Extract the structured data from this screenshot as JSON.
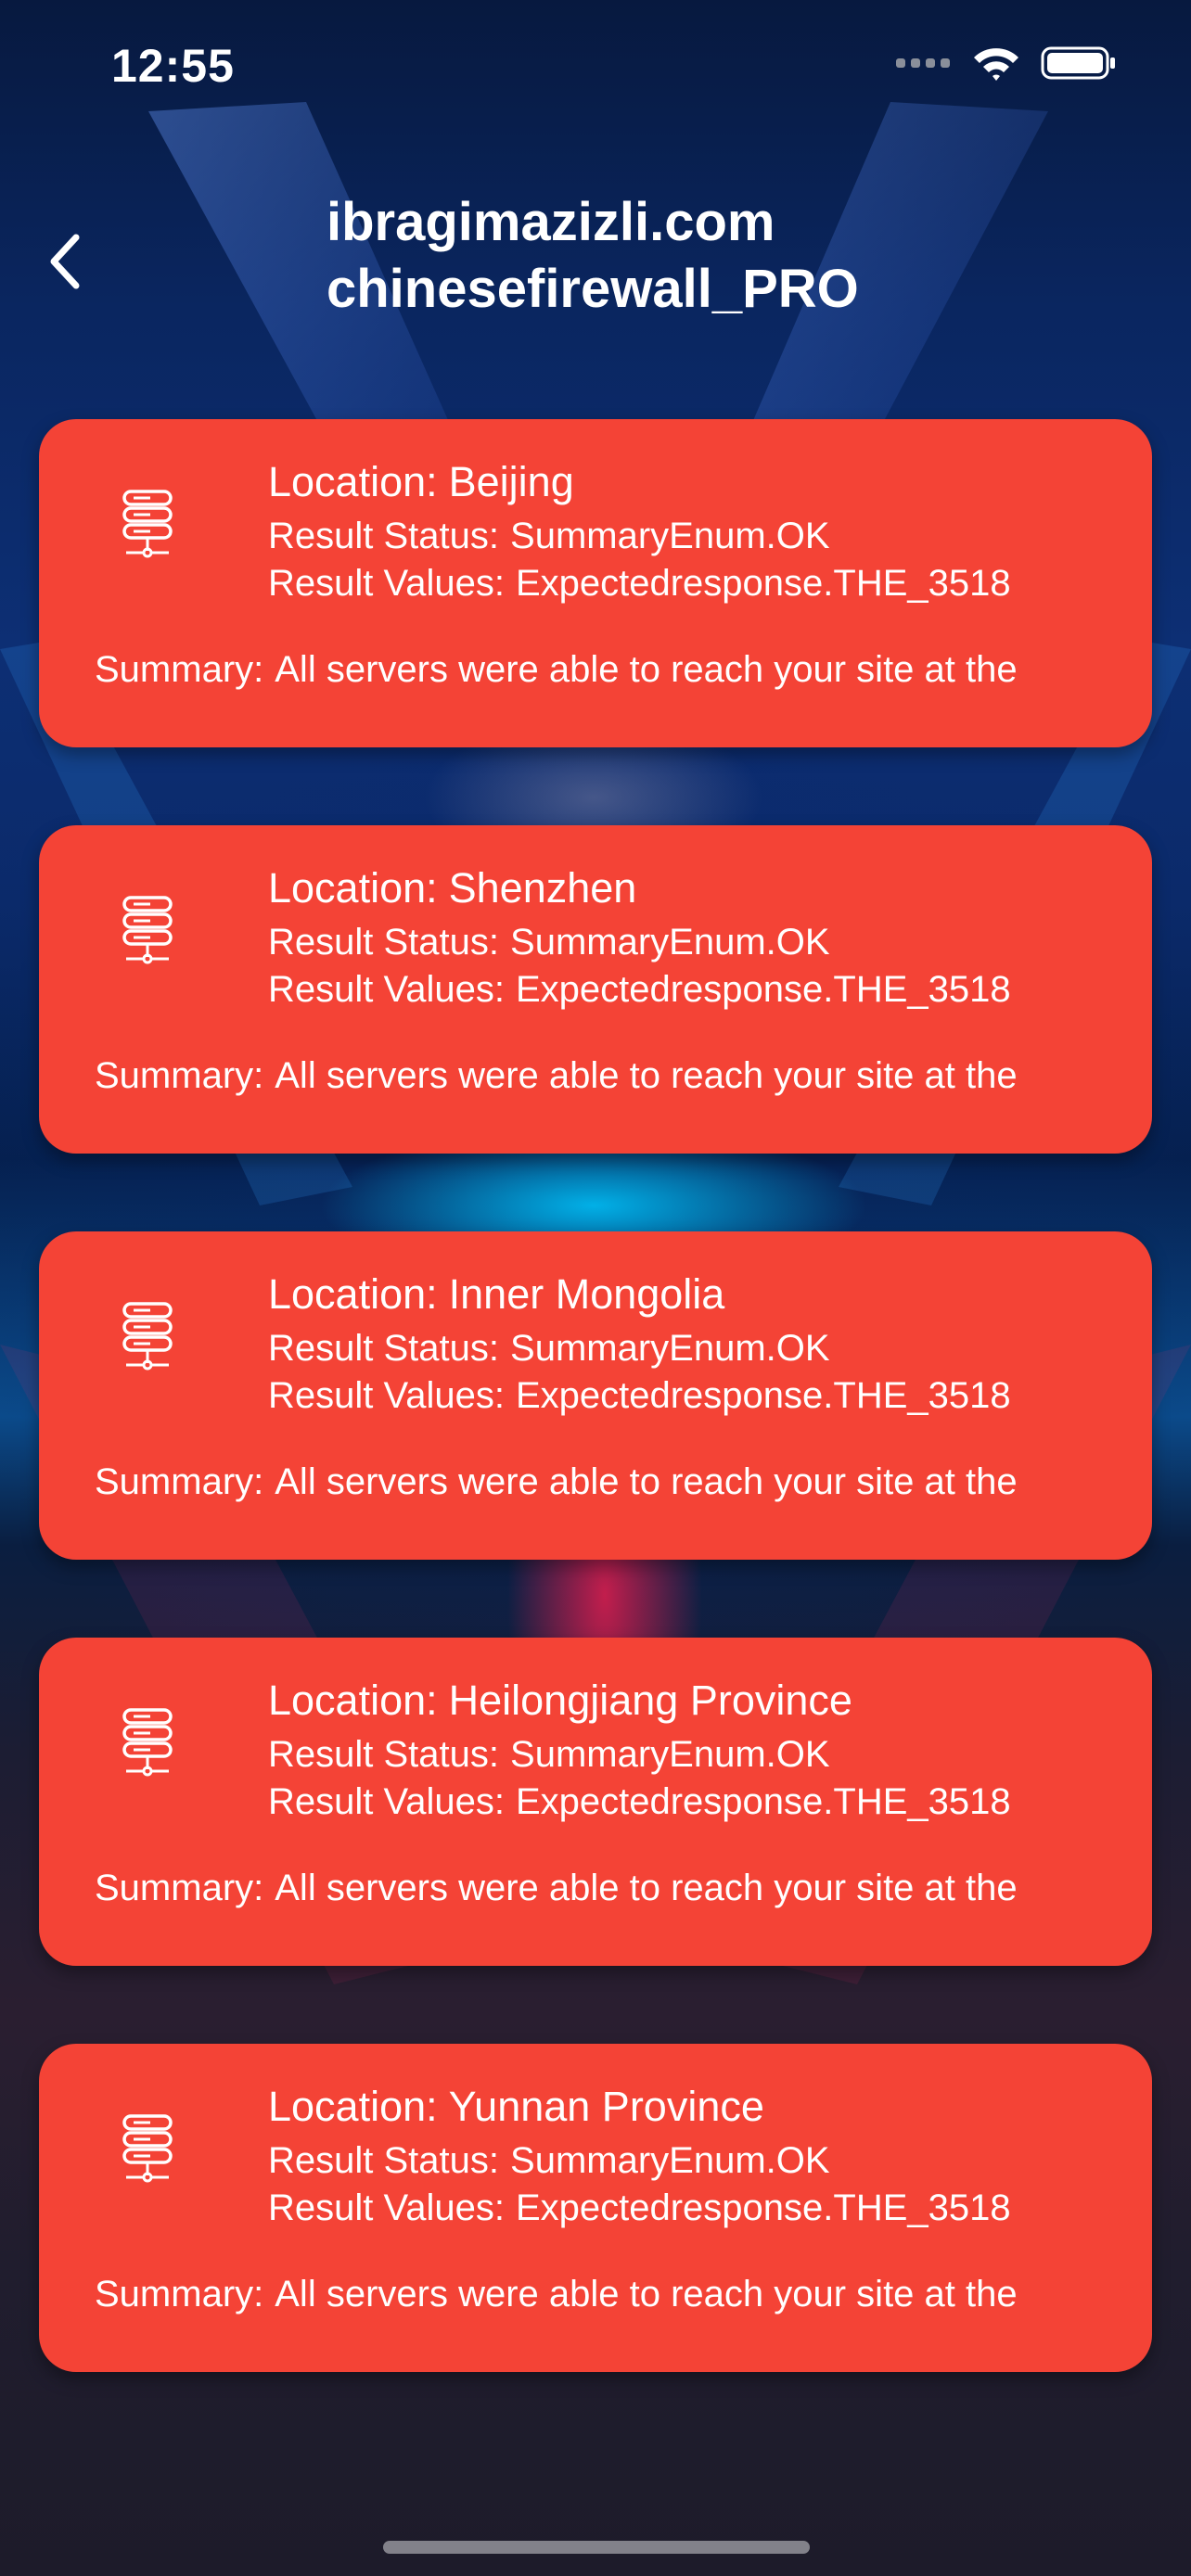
{
  "status_bar": {
    "time": "12:55",
    "icons": [
      "cellular-dots-icon",
      "wifi-icon",
      "battery-icon"
    ]
  },
  "header": {
    "back_icon": "chevron-left-icon",
    "title_line1": "ibragimazizli.com",
    "title_line2": "chinesefirewall_PRO"
  },
  "results": [
    {
      "icon": "server-icon",
      "location_label": "Location:",
      "location": "Beijing",
      "status_label": "Result Status:",
      "status": "SummaryEnum.OK",
      "values_label": "Result Values:",
      "values": "Expectedresponse.THE_3518",
      "summary_label": "Summary:",
      "summary": "All servers were able to reach your site at the"
    },
    {
      "icon": "server-icon",
      "location_label": "Location:",
      "location": "Shenzhen",
      "status_label": "Result Status:",
      "status": "SummaryEnum.OK",
      "values_label": "Result Values:",
      "values": "Expectedresponse.THE_3518",
      "summary_label": "Summary:",
      "summary": "All servers were able to reach your site at the"
    },
    {
      "icon": "server-icon",
      "location_label": "Location:",
      "location": "Inner Mongolia",
      "status_label": "Result Status:",
      "status": "SummaryEnum.OK",
      "values_label": "Result Values:",
      "values": "Expectedresponse.THE_3518",
      "summary_label": "Summary:",
      "summary": "All servers were able to reach your site at the"
    },
    {
      "icon": "server-icon",
      "location_label": "Location:",
      "location": "Heilongjiang Province",
      "status_label": "Result Status:",
      "status": "SummaryEnum.OK",
      "values_label": "Result Values:",
      "values": "Expectedresponse.THE_3518",
      "summary_label": "Summary:",
      "summary": "All servers were able to reach your site at the"
    },
    {
      "icon": "server-icon",
      "location_label": "Location:",
      "location": "Yunnan Province",
      "status_label": "Result Status:",
      "status": "SummaryEnum.OK",
      "values_label": "Result Values:",
      "values": "Expectedresponse.THE_3518",
      "summary_label": "Summary:",
      "summary": "All servers were able to reach your site at the"
    }
  ],
  "colors": {
    "card": "#f44336",
    "text": "#ffffff"
  }
}
